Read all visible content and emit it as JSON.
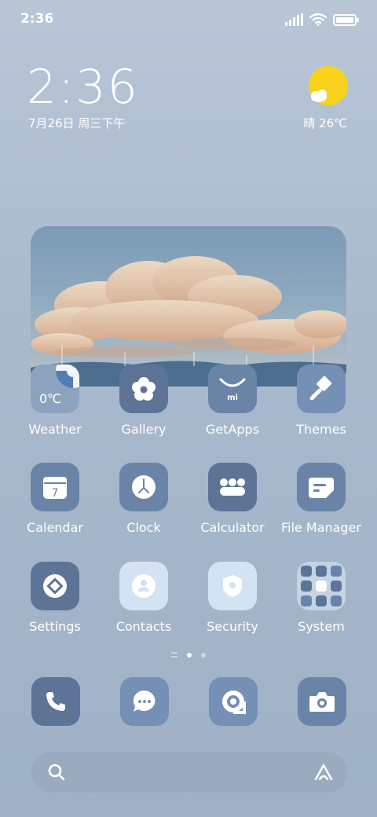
{
  "status_bar": {
    "time": "2:36"
  },
  "clock_widget": {
    "time": "2:36",
    "date": "7月26日 周三下午",
    "weather": "晴 26℃"
  },
  "apps_row1": [
    {
      "label": "Weather",
      "icon": "weather-icon",
      "temp": "0℃"
    },
    {
      "label": "Gallery",
      "icon": "gallery-icon"
    },
    {
      "label": "GetApps",
      "icon": "getapps-icon",
      "badge": "mi"
    },
    {
      "label": "Themes",
      "icon": "themes-icon"
    }
  ],
  "apps_row2": [
    {
      "label": "Calendar",
      "icon": "calendar-icon",
      "day": "7"
    },
    {
      "label": "Clock",
      "icon": "clock-icon"
    },
    {
      "label": "Calculator",
      "icon": "calculator-icon"
    },
    {
      "label": "File Manager",
      "icon": "file-manager-icon"
    }
  ],
  "apps_row3": [
    {
      "label": "Settings",
      "icon": "settings-icon"
    },
    {
      "label": "Contacts",
      "icon": "contacts-icon"
    },
    {
      "label": "Security",
      "icon": "security-icon"
    },
    {
      "label": "System",
      "icon": "folder-icon"
    }
  ],
  "dock": [
    "phone-icon",
    "messages-icon",
    "browser-icon",
    "camera-icon"
  ],
  "page_indicator": {
    "pages": 2,
    "active_page": 1
  },
  "colors": {
    "sun": "#f9d21c",
    "dark_icon": "#5d7497",
    "light_icon": "#d3e3f3"
  }
}
